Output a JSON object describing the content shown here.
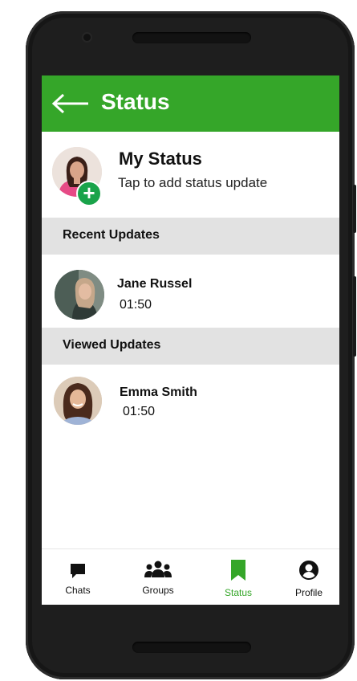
{
  "header": {
    "title": "Status"
  },
  "my_status": {
    "title": "My Status",
    "subtitle": "Tap to add status update",
    "add_symbol": "+"
  },
  "sections": {
    "recent": "Recent Updates",
    "viewed": "Viewed Updates"
  },
  "recent": [
    {
      "name": "Jane Russel",
      "time": "01:50"
    }
  ],
  "viewed": [
    {
      "name": "Emma Smith",
      "time": "01:50"
    }
  ],
  "nav": {
    "items": [
      {
        "label": "Chats",
        "icon": "chat-icon"
      },
      {
        "label": "Groups",
        "icon": "groups-icon"
      },
      {
        "label": "Status",
        "icon": "bookmark-icon",
        "active": true
      },
      {
        "label": "Profile",
        "icon": "profile-icon"
      }
    ]
  },
  "colors": {
    "accent": "#35a629",
    "badge": "#1aa34a",
    "section_bg": "#e2e2e2",
    "device": "#1e1e1e"
  }
}
